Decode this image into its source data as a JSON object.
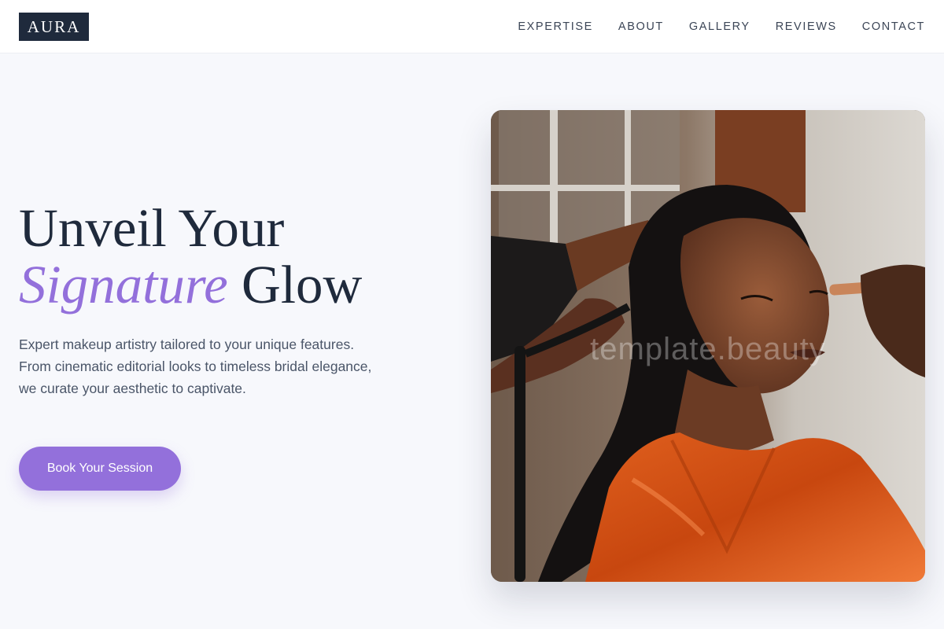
{
  "brand": {
    "logo_text": "AURA"
  },
  "nav": {
    "items": [
      {
        "label": "EXPERTISE"
      },
      {
        "label": "ABOUT"
      },
      {
        "label": "GALLERY"
      },
      {
        "label": "REVIEWS"
      },
      {
        "label": "CONTACT"
      }
    ]
  },
  "hero": {
    "headline_line1": "Unveil Your",
    "headline_accent": "Signature",
    "headline_line2_rest": " Glow",
    "description": "Expert makeup artistry tailored to your unique features. From cinematic editorial looks to timeless bridal elegance, we curate your aesthetic to captivate.",
    "cta_label": "Book Your Session",
    "image_watermark": "template.beauty"
  },
  "colors": {
    "accent": "#9370db",
    "navy": "#1f2a3c",
    "background": "#f7f8fc"
  }
}
